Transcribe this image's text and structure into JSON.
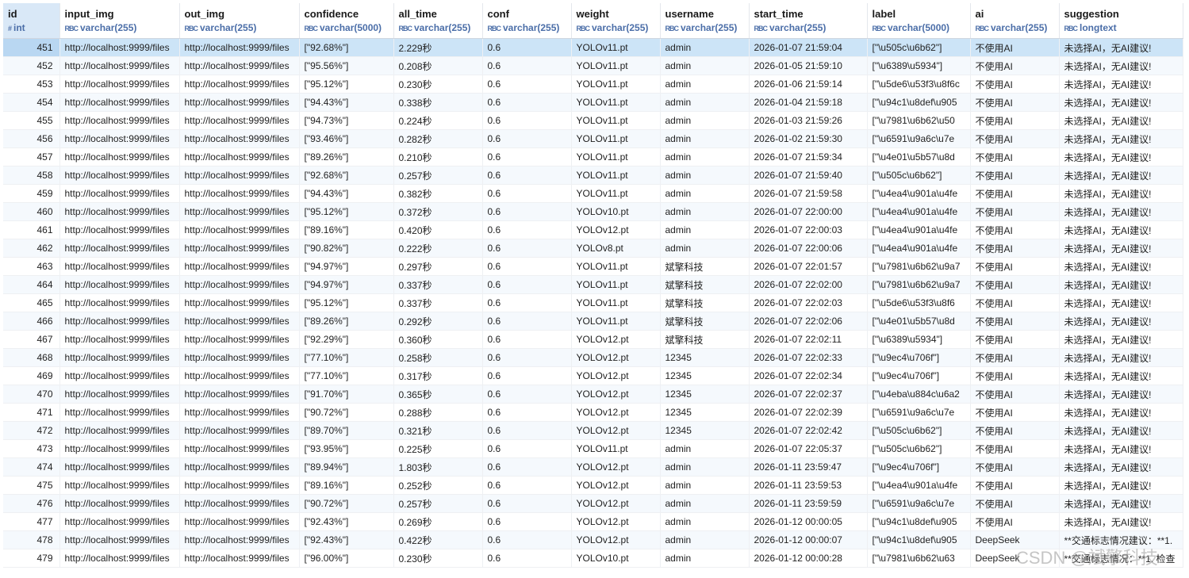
{
  "columns": [
    {
      "name": "id",
      "type": "int",
      "type_icon": "#"
    },
    {
      "name": "input_img",
      "type": "varchar(255)",
      "type_icon": "RBC"
    },
    {
      "name": "out_img",
      "type": "varchar(255)",
      "type_icon": "RBC"
    },
    {
      "name": "confidence",
      "type": "varchar(5000)",
      "type_icon": "RBC"
    },
    {
      "name": "all_time",
      "type": "varchar(255)",
      "type_icon": "RBC"
    },
    {
      "name": "conf",
      "type": "varchar(255)",
      "type_icon": "RBC"
    },
    {
      "name": "weight",
      "type": "varchar(255)",
      "type_icon": "RBC"
    },
    {
      "name": "username",
      "type": "varchar(255)",
      "type_icon": "RBC"
    },
    {
      "name": "start_time",
      "type": "varchar(255)",
      "type_icon": "RBC"
    },
    {
      "name": "label",
      "type": "varchar(5000)",
      "type_icon": "RBC"
    },
    {
      "name": "ai",
      "type": "varchar(255)",
      "type_icon": "RBC"
    },
    {
      "name": "suggestion",
      "type": "longtext",
      "type_icon": "RBC"
    }
  ],
  "rows": [
    [
      "451",
      "http://localhost:9999/files",
      "http://localhost:9999/files",
      "[\"92.68%\"]",
      "2.229秒",
      "0.6",
      "YOLOv11.pt",
      "admin",
      "2026-01-07 21:59:04",
      "[\"\\u505c\\u6b62\"]",
      "不使用AI",
      "未选择AI，无AI建议!"
    ],
    [
      "452",
      "http://localhost:9999/files",
      "http://localhost:9999/files",
      "[\"95.56%\"]",
      "0.208秒",
      "0.6",
      "YOLOv11.pt",
      "admin",
      "2026-01-05 21:59:10",
      "[\"\\u6389\\u5934\"]",
      "不使用AI",
      "未选择AI，无AI建议!"
    ],
    [
      "453",
      "http://localhost:9999/files",
      "http://localhost:9999/files",
      "[\"95.12%\"]",
      "0.230秒",
      "0.6",
      "YOLOv11.pt",
      "admin",
      "2026-01-06 21:59:14",
      "[\"\\u5de6\\u53f3\\u8f6c",
      "不使用AI",
      "未选择AI，无AI建议!"
    ],
    [
      "454",
      "http://localhost:9999/files",
      "http://localhost:9999/files",
      "[\"94.43%\"]",
      "0.338秒",
      "0.6",
      "YOLOv11.pt",
      "admin",
      "2026-01-04 21:59:18",
      "[\"\\u94c1\\u8def\\u905",
      "不使用AI",
      "未选择AI，无AI建议!"
    ],
    [
      "455",
      "http://localhost:9999/files",
      "http://localhost:9999/files",
      "[\"94.73%\"]",
      "0.224秒",
      "0.6",
      "YOLOv11.pt",
      "admin",
      "2026-01-03 21:59:26",
      "[\"\\u7981\\u6b62\\u50",
      "不使用AI",
      "未选择AI，无AI建议!"
    ],
    [
      "456",
      "http://localhost:9999/files",
      "http://localhost:9999/files",
      "[\"93.46%\"]",
      "0.282秒",
      "0.6",
      "YOLOv11.pt",
      "admin",
      "2026-01-02 21:59:30",
      "[\"\\u6591\\u9a6c\\u7e",
      "不使用AI",
      "未选择AI，无AI建议!"
    ],
    [
      "457",
      "http://localhost:9999/files",
      "http://localhost:9999/files",
      "[\"89.26%\"]",
      "0.210秒",
      "0.6",
      "YOLOv11.pt",
      "admin",
      "2026-01-07 21:59:34",
      "[\"\\u4e01\\u5b57\\u8d",
      "不使用AI",
      "未选择AI，无AI建议!"
    ],
    [
      "458",
      "http://localhost:9999/files",
      "http://localhost:9999/files",
      "[\"92.68%\"]",
      "0.257秒",
      "0.6",
      "YOLOv11.pt",
      "admin",
      "2026-01-07 21:59:40",
      "[\"\\u505c\\u6b62\"]",
      "不使用AI",
      "未选择AI，无AI建议!"
    ],
    [
      "459",
      "http://localhost:9999/files",
      "http://localhost:9999/files",
      "[\"94.43%\"]",
      "0.382秒",
      "0.6",
      "YOLOv11.pt",
      "admin",
      "2026-01-07 21:59:58",
      "[\"\\u4ea4\\u901a\\u4fe",
      "不使用AI",
      "未选择AI，无AI建议!"
    ],
    [
      "460",
      "http://localhost:9999/files",
      "http://localhost:9999/files",
      "[\"95.12%\"]",
      "0.372秒",
      "0.6",
      "YOLOv10.pt",
      "admin",
      "2026-01-07 22:00:00",
      "[\"\\u4ea4\\u901a\\u4fe",
      "不使用AI",
      "未选择AI，无AI建议!"
    ],
    [
      "461",
      "http://localhost:9999/files",
      "http://localhost:9999/files",
      "[\"89.16%\"]",
      "0.420秒",
      "0.6",
      "YOLOv12.pt",
      "admin",
      "2026-01-07 22:00:03",
      "[\"\\u4ea4\\u901a\\u4fe",
      "不使用AI",
      "未选择AI，无AI建议!"
    ],
    [
      "462",
      "http://localhost:9999/files",
      "http://localhost:9999/files",
      "[\"90.82%\"]",
      "0.222秒",
      "0.6",
      "YOLOv8.pt",
      "admin",
      "2026-01-07 22:00:06",
      "[\"\\u4ea4\\u901a\\u4fe",
      "不使用AI",
      "未选择AI，无AI建议!"
    ],
    [
      "463",
      "http://localhost:9999/files",
      "http://localhost:9999/files",
      "[\"94.97%\"]",
      "0.297秒",
      "0.6",
      "YOLOv11.pt",
      "斌擎科技",
      "2026-01-07 22:01:57",
      "[\"\\u7981\\u6b62\\u9a7",
      "不使用AI",
      "未选择AI，无AI建议!"
    ],
    [
      "464",
      "http://localhost:9999/files",
      "http://localhost:9999/files",
      "[\"94.97%\"]",
      "0.337秒",
      "0.6",
      "YOLOv11.pt",
      "斌擎科技",
      "2026-01-07 22:02:00",
      "[\"\\u7981\\u6b62\\u9a7",
      "不使用AI",
      "未选择AI，无AI建议!"
    ],
    [
      "465",
      "http://localhost:9999/files",
      "http://localhost:9999/files",
      "[\"95.12%\"]",
      "0.337秒",
      "0.6",
      "YOLOv11.pt",
      "斌擎科技",
      "2026-01-07 22:02:03",
      "[\"\\u5de6\\u53f3\\u8f6",
      "不使用AI",
      "未选择AI，无AI建议!"
    ],
    [
      "466",
      "http://localhost:9999/files",
      "http://localhost:9999/files",
      "[\"89.26%\"]",
      "0.292秒",
      "0.6",
      "YOLOv11.pt",
      "斌擎科技",
      "2026-01-07 22:02:06",
      "[\"\\u4e01\\u5b57\\u8d",
      "不使用AI",
      "未选择AI，无AI建议!"
    ],
    [
      "467",
      "http://localhost:9999/files",
      "http://localhost:9999/files",
      "[\"92.29%\"]",
      "0.360秒",
      "0.6",
      "YOLOv12.pt",
      "斌擎科技",
      "2026-01-07 22:02:11",
      "[\"\\u6389\\u5934\"]",
      "不使用AI",
      "未选择AI，无AI建议!"
    ],
    [
      "468",
      "http://localhost:9999/files",
      "http://localhost:9999/files",
      "[\"77.10%\"]",
      "0.258秒",
      "0.6",
      "YOLOv12.pt",
      "12345",
      "2026-01-07 22:02:33",
      "[\"\\u9ec4\\u706f\"]",
      "不使用AI",
      "未选择AI，无AI建议!"
    ],
    [
      "469",
      "http://localhost:9999/files",
      "http://localhost:9999/files",
      "[\"77.10%\"]",
      "0.317秒",
      "0.6",
      "YOLOv12.pt",
      "12345",
      "2026-01-07 22:02:34",
      "[\"\\u9ec4\\u706f\"]",
      "不使用AI",
      "未选择AI，无AI建议!"
    ],
    [
      "470",
      "http://localhost:9999/files",
      "http://localhost:9999/files",
      "[\"91.70%\"]",
      "0.365秒",
      "0.6",
      "YOLOv12.pt",
      "12345",
      "2026-01-07 22:02:37",
      "[\"\\u4eba\\u884c\\u6a2",
      "不使用AI",
      "未选择AI，无AI建议!"
    ],
    [
      "471",
      "http://localhost:9999/files",
      "http://localhost:9999/files",
      "[\"90.72%\"]",
      "0.288秒",
      "0.6",
      "YOLOv12.pt",
      "12345",
      "2026-01-07 22:02:39",
      "[\"\\u6591\\u9a6c\\u7e",
      "不使用AI",
      "未选择AI，无AI建议!"
    ],
    [
      "472",
      "http://localhost:9999/files",
      "http://localhost:9999/files",
      "[\"89.70%\"]",
      "0.321秒",
      "0.6",
      "YOLOv12.pt",
      "12345",
      "2026-01-07 22:02:42",
      "[\"\\u505c\\u6b62\"]",
      "不使用AI",
      "未选择AI，无AI建议!"
    ],
    [
      "473",
      "http://localhost:9999/files",
      "http://localhost:9999/files",
      "[\"93.95%\"]",
      "0.225秒",
      "0.6",
      "YOLOv11.pt",
      "admin",
      "2026-01-07 22:05:37",
      "[\"\\u505c\\u6b62\"]",
      "不使用AI",
      "未选择AI，无AI建议!"
    ],
    [
      "474",
      "http://localhost:9999/files",
      "http://localhost:9999/files",
      "[\"89.94%\"]",
      "1.803秒",
      "0.6",
      "YOLOv12.pt",
      "admin",
      "2026-01-11 23:59:47",
      "[\"\\u9ec4\\u706f\"]",
      "不使用AI",
      "未选择AI，无AI建议!"
    ],
    [
      "475",
      "http://localhost:9999/files",
      "http://localhost:9999/files",
      "[\"89.16%\"]",
      "0.252秒",
      "0.6",
      "YOLOv12.pt",
      "admin",
      "2026-01-11 23:59:53",
      "[\"\\u4ea4\\u901a\\u4fe",
      "不使用AI",
      "未选择AI，无AI建议!"
    ],
    [
      "476",
      "http://localhost:9999/files",
      "http://localhost:9999/files",
      "[\"90.72%\"]",
      "0.257秒",
      "0.6",
      "YOLOv12.pt",
      "admin",
      "2026-01-11 23:59:59",
      "[\"\\u6591\\u9a6c\\u7e",
      "不使用AI",
      "未选择AI，无AI建议!"
    ],
    [
      "477",
      "http://localhost:9999/files",
      "http://localhost:9999/files",
      "[\"92.43%\"]",
      "0.269秒",
      "0.6",
      "YOLOv12.pt",
      "admin",
      "2026-01-12 00:00:05",
      "[\"\\u94c1\\u8def\\u905",
      "不使用AI",
      "未选择AI，无AI建议!"
    ],
    [
      "478",
      "http://localhost:9999/files",
      "http://localhost:9999/files",
      "[\"92.43%\"]",
      "0.422秒",
      "0.6",
      "YOLOv12.pt",
      "admin",
      "2026-01-12 00:00:07",
      "[\"\\u94c1\\u8def\\u905",
      "DeepSeek",
      "**交通标志情况建议：**1."
    ],
    [
      "479",
      "http://localhost:9999/files",
      "http://localhost:9999/files",
      "[\"96.00%\"]",
      "0.230秒",
      "0.6",
      "YOLOv10.pt",
      "admin",
      "2026-01-12 00:00:28",
      "[\"\\u7981\\u6b62\\u63",
      "DeepSeek",
      "**交通标志情况：**1. 检查"
    ]
  ],
  "selected_row_id": "451",
  "watermark": "CSDN @斌擎科技"
}
